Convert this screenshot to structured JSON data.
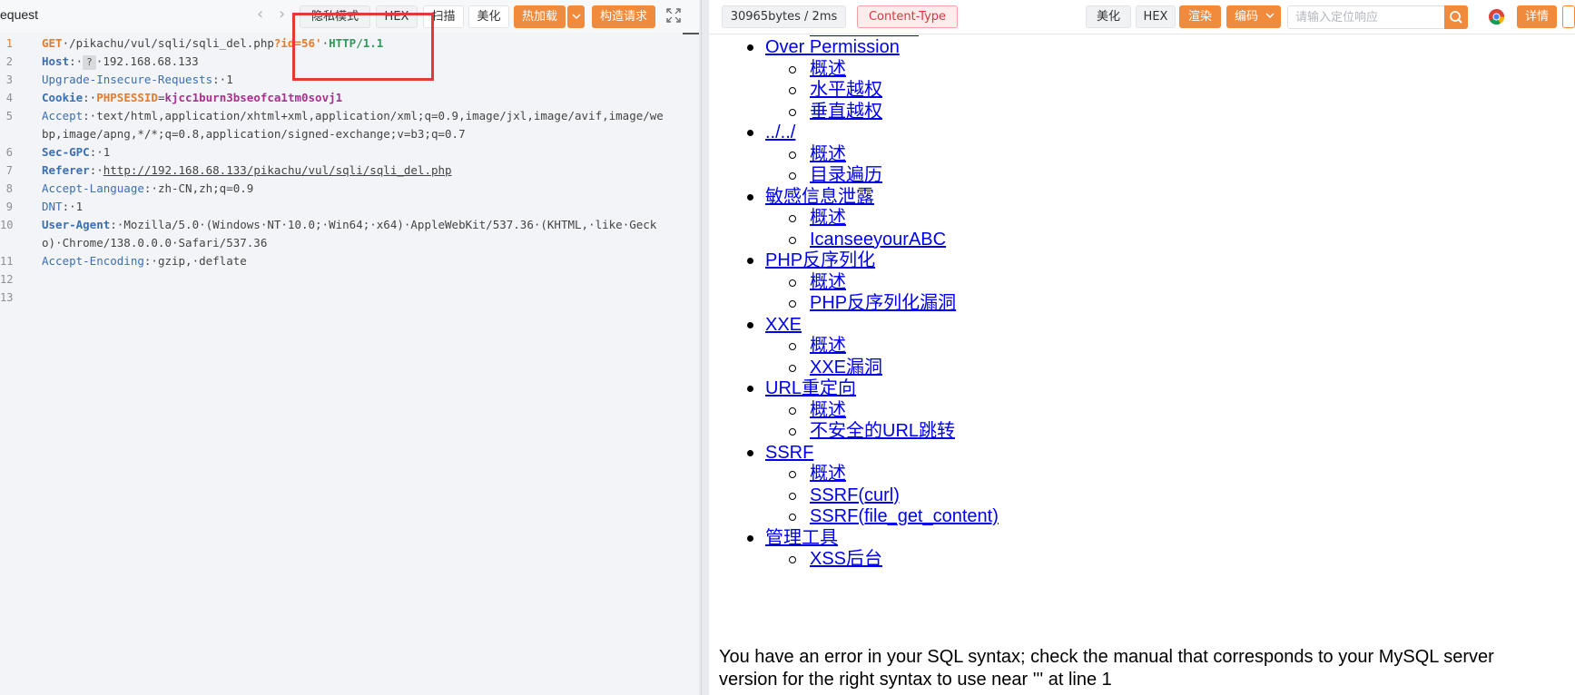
{
  "request": {
    "title": "equest",
    "buttons": {
      "privacy": "隐私模式",
      "hex": "HEX",
      "scan": "扫描",
      "beautify": "美化",
      "hot_load": "热加载",
      "build": "构造请求"
    },
    "lines": [
      {
        "no": "1",
        "parts": [
          [
            "k-method",
            "GET"
          ],
          [
            "",
            "·/pikachu/vul/sqli/sqli_del.php"
          ],
          [
            "k-orange",
            "?id=56'"
          ],
          [
            "",
            "·"
          ],
          [
            "k-green",
            "HTTP/1.1"
          ]
        ]
      },
      {
        "no": "2",
        "parts": [
          [
            "k-bold",
            "Host"
          ],
          [
            "",
            ":·"
          ],
          [
            "hint",
            "?"
          ],
          [
            "",
            "·192.168.68.133"
          ]
        ]
      },
      {
        "no": "3",
        "parts": [
          [
            "k-plain",
            "Upgrade-Insecure-Requests"
          ],
          [
            "",
            ":·1"
          ]
        ]
      },
      {
        "no": "4",
        "parts": [
          [
            "k-bold",
            "Cookie"
          ],
          [
            "",
            ":·"
          ],
          [
            "k-orange",
            "PHPSESSID"
          ],
          [
            "",
            "="
          ],
          [
            "k-purple",
            "kjcc1burn3bseofca1tm0sovj1"
          ]
        ]
      },
      {
        "no": "5",
        "tall": true,
        "parts": [
          [
            "k-plain",
            "Accept"
          ],
          [
            "",
            ":·text/html,application/xhtml+xml,application/xml;q=0.9,image/jxl,image/avif,image/webp,image/apng,*/*;q=0.8,application/signed-exchange;v=b3;q=0.7"
          ]
        ]
      },
      {
        "no": "6",
        "parts": [
          [
            "k-bold",
            "Sec-GPC"
          ],
          [
            "",
            ":·1"
          ]
        ]
      },
      {
        "no": "7",
        "parts": [
          [
            "k-bold",
            "Referer"
          ],
          [
            "",
            ":·"
          ],
          [
            "k-url",
            "http://192.168.68.133/pikachu/vul/sqli/sqli_del.php"
          ]
        ]
      },
      {
        "no": "8",
        "parts": [
          [
            "k-plain",
            "Accept-Language"
          ],
          [
            "",
            ":·zh-CN,zh;q=0.9"
          ]
        ]
      },
      {
        "no": "9",
        "parts": [
          [
            "k-plain",
            "DNT"
          ],
          [
            "",
            ":·1"
          ]
        ]
      },
      {
        "no": "10",
        "tall": true,
        "parts": [
          [
            "k-bold",
            "User-Agent"
          ],
          [
            "",
            ":·Mozilla/5.0·(Windows·NT·10.0;·Win64;·x64)·AppleWebKit/537.36·(KHTML,·like·Gecko)·Chrome/138.0.0.0·Safari/537.36"
          ]
        ]
      },
      {
        "no": "11",
        "parts": [
          [
            "k-plain",
            "Accept-Encoding"
          ],
          [
            "",
            ":·gzip,·deflate"
          ]
        ]
      },
      {
        "no": "12",
        "parts": []
      },
      {
        "no": "13",
        "parts": []
      }
    ]
  },
  "response": {
    "size_time": "30965bytes / 2ms",
    "content_type": "Content-Type",
    "buttons": {
      "beautify": "美化",
      "hex": "HEX",
      "render": "渲染",
      "encode": "编码",
      "details": "详情"
    },
    "search_placeholder": "请输入定位响应",
    "menu": [
      {
        "label": "Over Permission",
        "children": [
          "概述",
          "水平越权",
          "垂直越权"
        ]
      },
      {
        "label": "../../",
        "children": [
          "概述",
          "目录遍历"
        ]
      },
      {
        "label": "敏感信息泄露",
        "children": [
          "概述",
          "IcanseeyourABC"
        ]
      },
      {
        "label": "PHP反序列化",
        "children": [
          "概述",
          "PHP反序列化漏洞"
        ]
      },
      {
        "label": "XXE",
        "children": [
          "概述",
          "XXE漏洞"
        ]
      },
      {
        "label": "URL重定向",
        "children": [
          "概述",
          "不安全的URL跳转"
        ]
      },
      {
        "label": "SSRF",
        "children": [
          "概述",
          "SSRF(curl)",
          "SSRF(file_get_content)"
        ]
      },
      {
        "label": "管理工具",
        "children": [
          "XSS后台"
        ]
      }
    ],
    "error_message": "You have an error in your SQL syntax; check the manual that corresponds to your MySQL server version for the right syntax to use near ''' at line 1"
  }
}
